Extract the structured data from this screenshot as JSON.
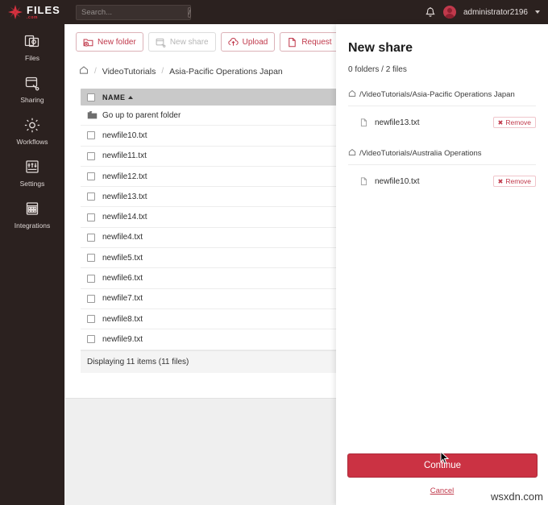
{
  "brand": {
    "name": "FILES",
    "suffix": ".com",
    "accent": "#c0394b",
    "dark": "#2b211f"
  },
  "topbar": {
    "search_placeholder": "Search...",
    "search_value": "",
    "shortcut_key": "/",
    "bell_icon": "bell-icon",
    "user": "administrator2196"
  },
  "sidebar": {
    "items": [
      {
        "label": "Files",
        "icon": "files-icon"
      },
      {
        "label": "Sharing",
        "icon": "sharing-icon"
      },
      {
        "label": "Workflows",
        "icon": "gear-icon"
      },
      {
        "label": "Settings",
        "icon": "sliders-icon"
      },
      {
        "label": "Integrations",
        "icon": "grid-icon"
      }
    ]
  },
  "toolbar": {
    "buttons": [
      {
        "label": "New folder",
        "icon": "new-folder-icon",
        "disabled": false
      },
      {
        "label": "New share",
        "icon": "new-share-icon",
        "disabled": true
      },
      {
        "label": "Upload",
        "icon": "upload-icon",
        "disabled": false
      },
      {
        "label": "Request",
        "icon": "request-icon",
        "disabled": false
      }
    ],
    "link_icon": "link-icon",
    "overflow_chevron": "chevron-right-icon"
  },
  "breadcrumb": {
    "home_icon": "home-icon",
    "items": [
      "VideoTutorials",
      "Asia-Pacific Operations Japan"
    ],
    "separator": "/"
  },
  "filelist": {
    "header": {
      "name_label": "NAME",
      "sort": "asc"
    },
    "parent_row": {
      "label": "Go up to parent folder",
      "icon": "parent-folder-icon"
    },
    "rows": [
      {
        "name": "newfile10.txt",
        "checked": false
      },
      {
        "name": "newfile11.txt",
        "checked": false
      },
      {
        "name": "newfile12.txt",
        "checked": false
      },
      {
        "name": "newfile13.txt",
        "checked": false
      },
      {
        "name": "newfile14.txt",
        "checked": false
      },
      {
        "name": "newfile4.txt",
        "checked": false
      },
      {
        "name": "newfile5.txt",
        "checked": false
      },
      {
        "name": "newfile6.txt",
        "checked": false
      },
      {
        "name": "newfile7.txt",
        "checked": false
      },
      {
        "name": "newfile8.txt",
        "checked": false
      },
      {
        "name": "newfile9.txt",
        "checked": false
      }
    ],
    "footer": "Displaying 11 items (11 files)"
  },
  "drawer": {
    "title": "New share",
    "summary": "0 folders / 2 files",
    "groups": [
      {
        "path": "/VideoTutorials/Asia-Pacific Operations Japan",
        "home_icon": "home-icon",
        "files": [
          {
            "name": "newfile13.txt",
            "remove_label": "Remove"
          }
        ]
      },
      {
        "path": "/VideoTutorials/Australia Operations",
        "home_icon": "home-icon",
        "files": [
          {
            "name": "newfile10.txt",
            "remove_label": "Remove"
          }
        ]
      }
    ],
    "continue_label": "Continue",
    "cancel_label": "Cancel"
  },
  "watermark": "wsxdn.com"
}
